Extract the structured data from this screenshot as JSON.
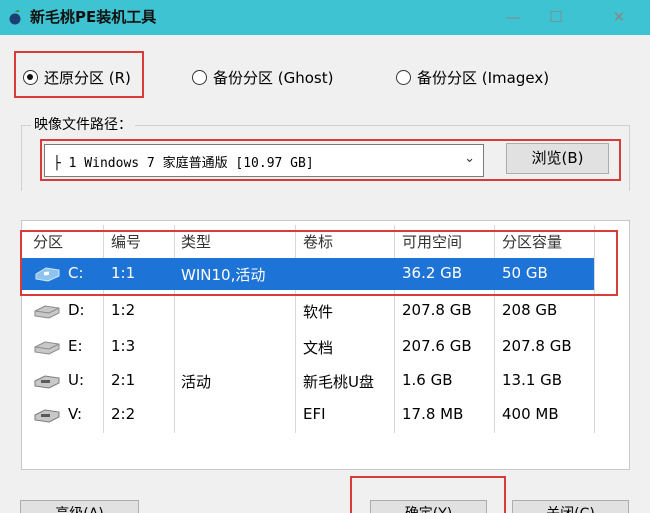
{
  "window": {
    "title": "新毛桃PE装机工具",
    "minimize_glyph": "—",
    "maximize_glyph": "☐",
    "close_glyph": "✕",
    "accent": "#3ec3d3"
  },
  "modes": [
    {
      "label": "还原分区 (R)",
      "checked": true
    },
    {
      "label": "备份分区 (Ghost)",
      "checked": false
    },
    {
      "label": "备份分区 (Imagex)",
      "checked": false
    }
  ],
  "image_path": {
    "label": "映像文件路径：",
    "value": "├ 1 Windows 7 家庭普通版 [10.97 GB]",
    "dropdown_icon": "chevron-down-icon",
    "browse_label": "浏览(B)"
  },
  "partition_table": {
    "columns": [
      "分区",
      "编号",
      "类型",
      "卷标",
      "可用空间",
      "分区容量"
    ],
    "rows": [
      {
        "drive": "C:",
        "number": "1:1",
        "type": "WIN10,活动",
        "label": "",
        "free": "36.2 GB",
        "capacity": "50 GB",
        "selected": true,
        "icon": "windows-drive-icon"
      },
      {
        "drive": "D:",
        "number": "1:2",
        "type": "",
        "label": "软件",
        "free": "207.8 GB",
        "capacity": "208 GB",
        "selected": false,
        "icon": "hard-drive-icon"
      },
      {
        "drive": "E:",
        "number": "1:3",
        "type": "",
        "label": "文档",
        "free": "207.6 GB",
        "capacity": "207.8 GB",
        "selected": false,
        "icon": "hard-drive-icon"
      },
      {
        "drive": "U:",
        "number": "2:1",
        "type": "活动",
        "label": "新毛桃U盘",
        "free": "1.6 GB",
        "capacity": "13.1 GB",
        "selected": false,
        "icon": "usb-drive-icon"
      },
      {
        "drive": "V:",
        "number": "2:2",
        "type": "",
        "label": "EFI",
        "free": "17.8 MB",
        "capacity": "400 MB",
        "selected": false,
        "icon": "usb-drive-icon"
      }
    ]
  },
  "buttons": {
    "advanced": "高级(A)",
    "confirm": "确定(Y)",
    "close": "关闭(C)"
  },
  "colors": {
    "selection": "#1e74d6",
    "highlight_box": "#d93a3a"
  }
}
